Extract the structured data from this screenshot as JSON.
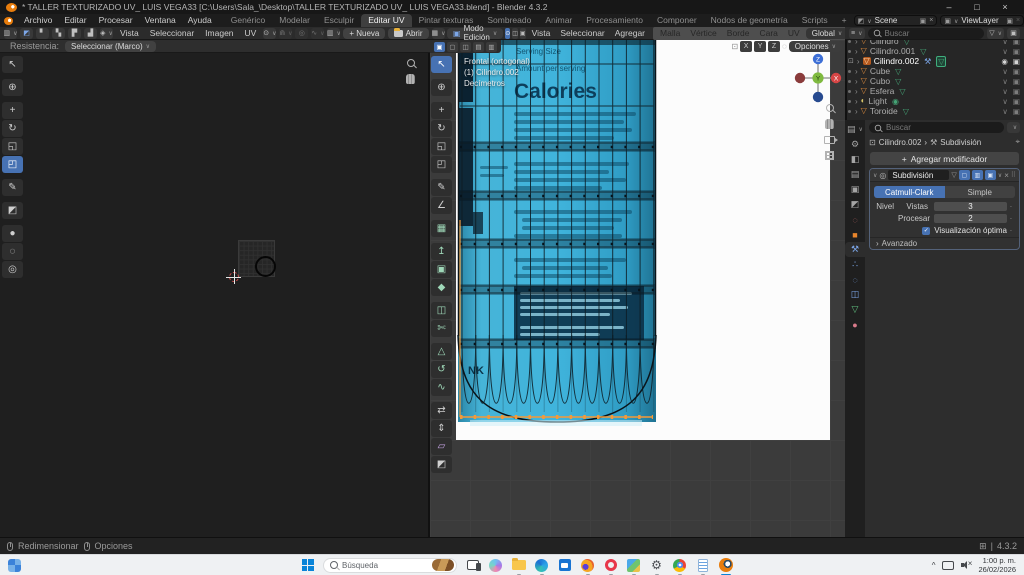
{
  "window": {
    "title": "* TALLER TEXTURIZADO UV_ LUIS VEGA33 [C:\\Users\\Sala_\\Desktop\\TALLER TEXTURIZADO UV_ LUIS VEGA33.blend] - Blender 4.3.2",
    "minimize": "–",
    "maximize": "□",
    "close": "×"
  },
  "menubar": {
    "menus": [
      "Archivo",
      "Editar",
      "Procesar",
      "Ventana",
      "Ayuda"
    ],
    "workspaces": [
      "Genérico",
      "Modelar",
      "Esculpir",
      "Editar UV",
      "Pintar texturas",
      "Sombreado",
      "Animar",
      "Procesamiento",
      "Componer",
      "Nodos de geometría",
      "Scripts",
      "+"
    ],
    "scene_label": "Scene",
    "view_layer_label": "ViewLayer"
  },
  "uv_editor": {
    "menus": [
      "Vista",
      "Seleccionar",
      "Imagen",
      "UV"
    ],
    "new_button": "Nueva",
    "open_button": "Abrir",
    "strength_label": "Resistencia:",
    "tool_select": "Seleccionar (Marco)"
  },
  "viewport": {
    "mode": "Modo Edición",
    "menus": [
      "Vista",
      "Seleccionar",
      "Agregar",
      "Malla",
      "Vértice",
      "Borde",
      "Cara",
      "UV"
    ],
    "orientation": "Global",
    "axes": [
      "X",
      "Y",
      "Z"
    ],
    "options_label": "Opciones",
    "overlay": {
      "view": "Frontal (ortogonal)",
      "object": "(1) Cilindro.002",
      "units": "Decímetros"
    },
    "gizmo": {
      "x": "X",
      "y": "Y",
      "z": "Z"
    },
    "bottle": {
      "serving": "Serving Size",
      "amount": "Amount per serving",
      "calories": "Calories",
      "base_text": "NK"
    }
  },
  "outliner": {
    "search_placeholder": "Buscar",
    "items": [
      {
        "name": "Cilindro",
        "type": "mesh",
        "selected": false
      },
      {
        "name": "Cilindro.001",
        "type": "mesh",
        "selected": false
      },
      {
        "name": "Cilindro.002",
        "type": "mesh",
        "selected": true
      },
      {
        "name": "Cube",
        "type": "mesh",
        "selected": false
      },
      {
        "name": "Cubo",
        "type": "mesh",
        "selected": false
      },
      {
        "name": "Esfera",
        "type": "mesh",
        "selected": false
      },
      {
        "name": "Light",
        "type": "light",
        "selected": false
      },
      {
        "name": "Toroide",
        "type": "mesh",
        "selected": false
      }
    ]
  },
  "properties": {
    "search_placeholder": "Buscar",
    "breadcrumb_object": "Cilindro.002",
    "breadcrumb_separator": "›",
    "breadcrumb_modifier": "Subdivisión",
    "add_modifier_label": "Agregar modificador",
    "modifier": {
      "name": "Subdivisión",
      "type_catmull": "Catmull-Clark",
      "type_simple": "Simple",
      "level_label": "Nivel",
      "viewport_label": "Vistas",
      "viewport_value": "3",
      "render_label": "Procesar",
      "render_value": "2",
      "optimal_label": "Visualización óptima",
      "advanced_label": "Avanzado"
    }
  },
  "statusbar": {
    "resize_label": "Redimensionar",
    "options_label": "Opciones",
    "version": "4.3.2"
  },
  "taskbar": {
    "search_placeholder": "Búsqueda",
    "time": "1:00 p. m.",
    "date": "26/02/2026"
  },
  "glyphs": {
    "chevron": "∨",
    "expand": "›",
    "plus": "+",
    "check": "✓",
    "pin": "⌖",
    "copy": "▣",
    "menu": "≡",
    "image": "▥",
    "funnel": "▽",
    "drag": "⠿",
    "grid": "⊞",
    "pipe": "|",
    "mesh": "▽",
    "mesh_data": "▽",
    "light": "◐",
    "wrench": "⚒",
    "eye": "◉",
    "monitor": "∨",
    "camera": "▣",
    "tools": {
      "tweak": "↖",
      "cursor": "⊕",
      "move": "+",
      "rotate": "↻",
      "scale": "◱",
      "transform": "◰",
      "annotate": "✎",
      "measure": "∠",
      "add_cube": "▦",
      "extrude": "↥",
      "inset": "▣",
      "bevel": "◆",
      "loop_cut": "◫",
      "knife": "✄",
      "poly_build": "△",
      "spin": "↺",
      "smooth": "∿",
      "edge_slide": "⇄",
      "shrink_fatten": "⇕",
      "shear": "▱",
      "rip": "◩",
      "grab": "●",
      "relax": "◌",
      "pinch": "◎"
    },
    "select_modes": [
      "⊙",
      "◫",
      "▣"
    ],
    "vp_mini": [
      "▣",
      "▢",
      "◫",
      "▤",
      "▥"
    ],
    "prop_tabs": {
      "tool": "⚙",
      "render": "◧",
      "output": "▤",
      "view_layer": "▣",
      "scene": "◩",
      "world": "◌",
      "object": "■",
      "modifiers": "⚒",
      "particles": "∴",
      "physics": "◌",
      "constraints": "◫",
      "data": "▽",
      "material": "●"
    }
  },
  "colors": {
    "accent_blue": "#4772b3",
    "selection_orange": "#e8852c",
    "bottle_cyan": "#3fb0d6",
    "taskbar_bg": "#eff1f3"
  }
}
